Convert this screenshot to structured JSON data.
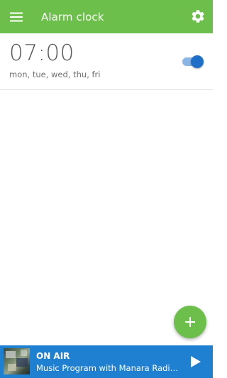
{
  "colors": {
    "app_bar": "#6cbf4a",
    "fab": "#6cbf4a",
    "player_bar": "#1f7fd0",
    "toggle_track": "#8ab6e6",
    "toggle_thumb": "#1f6fc8"
  },
  "header": {
    "title": "Alarm clock",
    "menu_icon": "hamburger-menu-icon",
    "settings_icon": "gear-icon"
  },
  "alarms": [
    {
      "time": "07:00",
      "days": "mon, tue, wed, thu, fri",
      "enabled": true
    }
  ],
  "fab": {
    "icon": "plus-icon"
  },
  "player": {
    "status": "ON AIR",
    "program": "Music Program with Manara Radio I...",
    "play_icon": "play-icon",
    "thumbnail_icon": "station-thumbnail"
  }
}
